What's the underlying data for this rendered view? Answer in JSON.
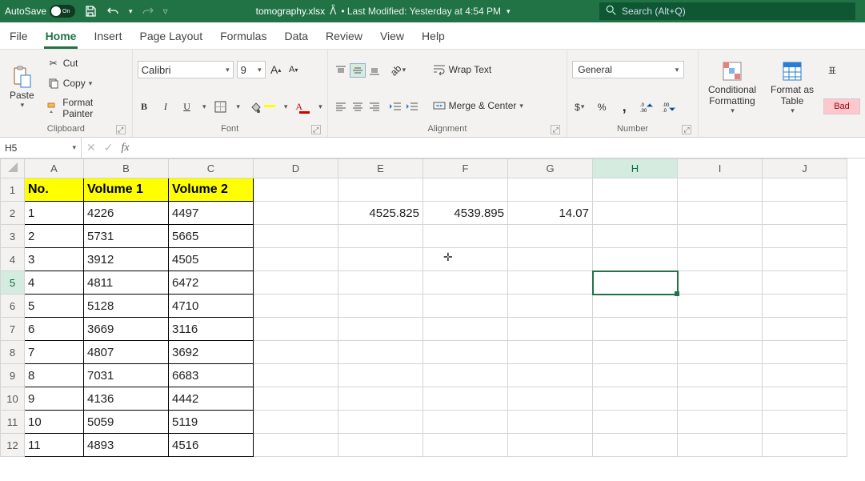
{
  "titlebar": {
    "autosave_label": "AutoSave",
    "autosave_state": "On",
    "filename": "tomography.xlsx",
    "modified": "• Last Modified: Yesterday at 4:54 PM",
    "search_placeholder": "Search (Alt+Q)"
  },
  "menu": {
    "file": "File",
    "home": "Home",
    "insert": "Insert",
    "page_layout": "Page Layout",
    "formulas": "Formulas",
    "data": "Data",
    "review": "Review",
    "view": "View",
    "help": "Help"
  },
  "ribbon": {
    "paste": "Paste",
    "cut": "Cut",
    "copy": "Copy",
    "format_painter": "Format Painter",
    "clipboard_label": "Clipboard",
    "font_name": "Calibri",
    "font_size": "9",
    "font_label": "Font",
    "wrap_text": "Wrap Text",
    "merge_center": "Merge & Center",
    "alignment_label": "Alignment",
    "number_format": "General",
    "number_label": "Number",
    "conditional_formatting": "Conditional\nFormatting",
    "format_as_table": "Format as\nTable",
    "bad_style": "Bad"
  },
  "namebox": "H5",
  "formula": "",
  "grid": {
    "columns": [
      "A",
      "B",
      "C",
      "D",
      "E",
      "F",
      "G",
      "H",
      "I",
      "J"
    ],
    "active_col": "H",
    "active_row_num": 5,
    "headers": {
      "A": "No.",
      "B": "Volume 1",
      "C": "Volume 2"
    },
    "rows": [
      {
        "n": 1,
        "A": "1",
        "B": "4226",
        "C": "4497",
        "E": "4525.825",
        "F": "4539.895",
        "G": "14.07"
      },
      {
        "n": 2,
        "A": "2",
        "B": "5731",
        "C": "5665"
      },
      {
        "n": 3,
        "A": "3",
        "B": "3912",
        "C": "4505"
      },
      {
        "n": 4,
        "A": "4",
        "B": "4811",
        "C": "6472"
      },
      {
        "n": 5,
        "A": "5",
        "B": "5128",
        "C": "4710"
      },
      {
        "n": 6,
        "A": "6",
        "B": "3669",
        "C": "3116"
      },
      {
        "n": 7,
        "A": "7",
        "B": "4807",
        "C": "3692"
      },
      {
        "n": 8,
        "A": "8",
        "B": "7031",
        "C": "6683"
      },
      {
        "n": 9,
        "A": "9",
        "B": "4136",
        "C": "4442"
      },
      {
        "n": 10,
        "A": "10",
        "B": "5059",
        "C": "5119"
      },
      {
        "n": 11,
        "A": "11",
        "B": "4893",
        "C": "4516"
      }
    ]
  }
}
